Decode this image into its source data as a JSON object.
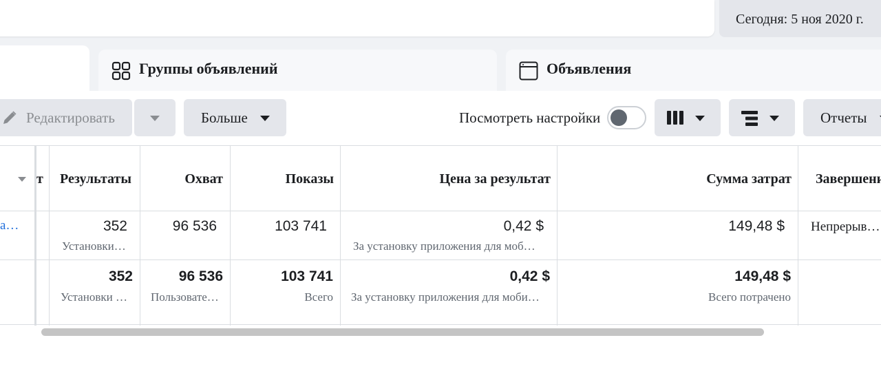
{
  "header": {
    "date_label": "Сегодня: 5 ноя 2020 г."
  },
  "tabs": {
    "ad_groups": "Группы объявлений",
    "ads": "Объявления"
  },
  "toolbar": {
    "edit_label": "Редактировать",
    "more_label": "Больше",
    "view_settings_label": "Посмотреть настройки",
    "reports_label": "Отчеты"
  },
  "table": {
    "headers": {
      "partial": "т",
      "results": "Результаты",
      "reach": "Охват",
      "impressions": "Показы",
      "cost_per_result": "Цена за результат",
      "amount_spent": "Сумма затрат",
      "ends": "Завершение"
    },
    "row1": {
      "name_fragment": "a…",
      "results": "352",
      "results_sub": "Установки…",
      "reach": "96 536",
      "impressions": "103 741",
      "cost_per_result": "0,42 $",
      "cost_sub": "За установку приложения для моб…",
      "amount_spent": "149,48 $",
      "ends": "Непрерыв…"
    },
    "totals": {
      "results": "352",
      "results_sub": "Установки …",
      "reach": "96 536",
      "reach_sub": "Пользовате…",
      "impressions": "103 741",
      "impressions_sub": "Всего",
      "cost_per_result": "0,42 $",
      "cost_sub": "За установку приложения для моби…",
      "amount_spent": "149,48 $",
      "amount_sub": "Всего потрачено"
    }
  },
  "icons": {
    "ad_groups": "grid-icon",
    "ads": "ad-window-icon",
    "edit": "pencil-icon",
    "columns": "columns-icon",
    "breakdown": "breakdown-icon"
  }
}
